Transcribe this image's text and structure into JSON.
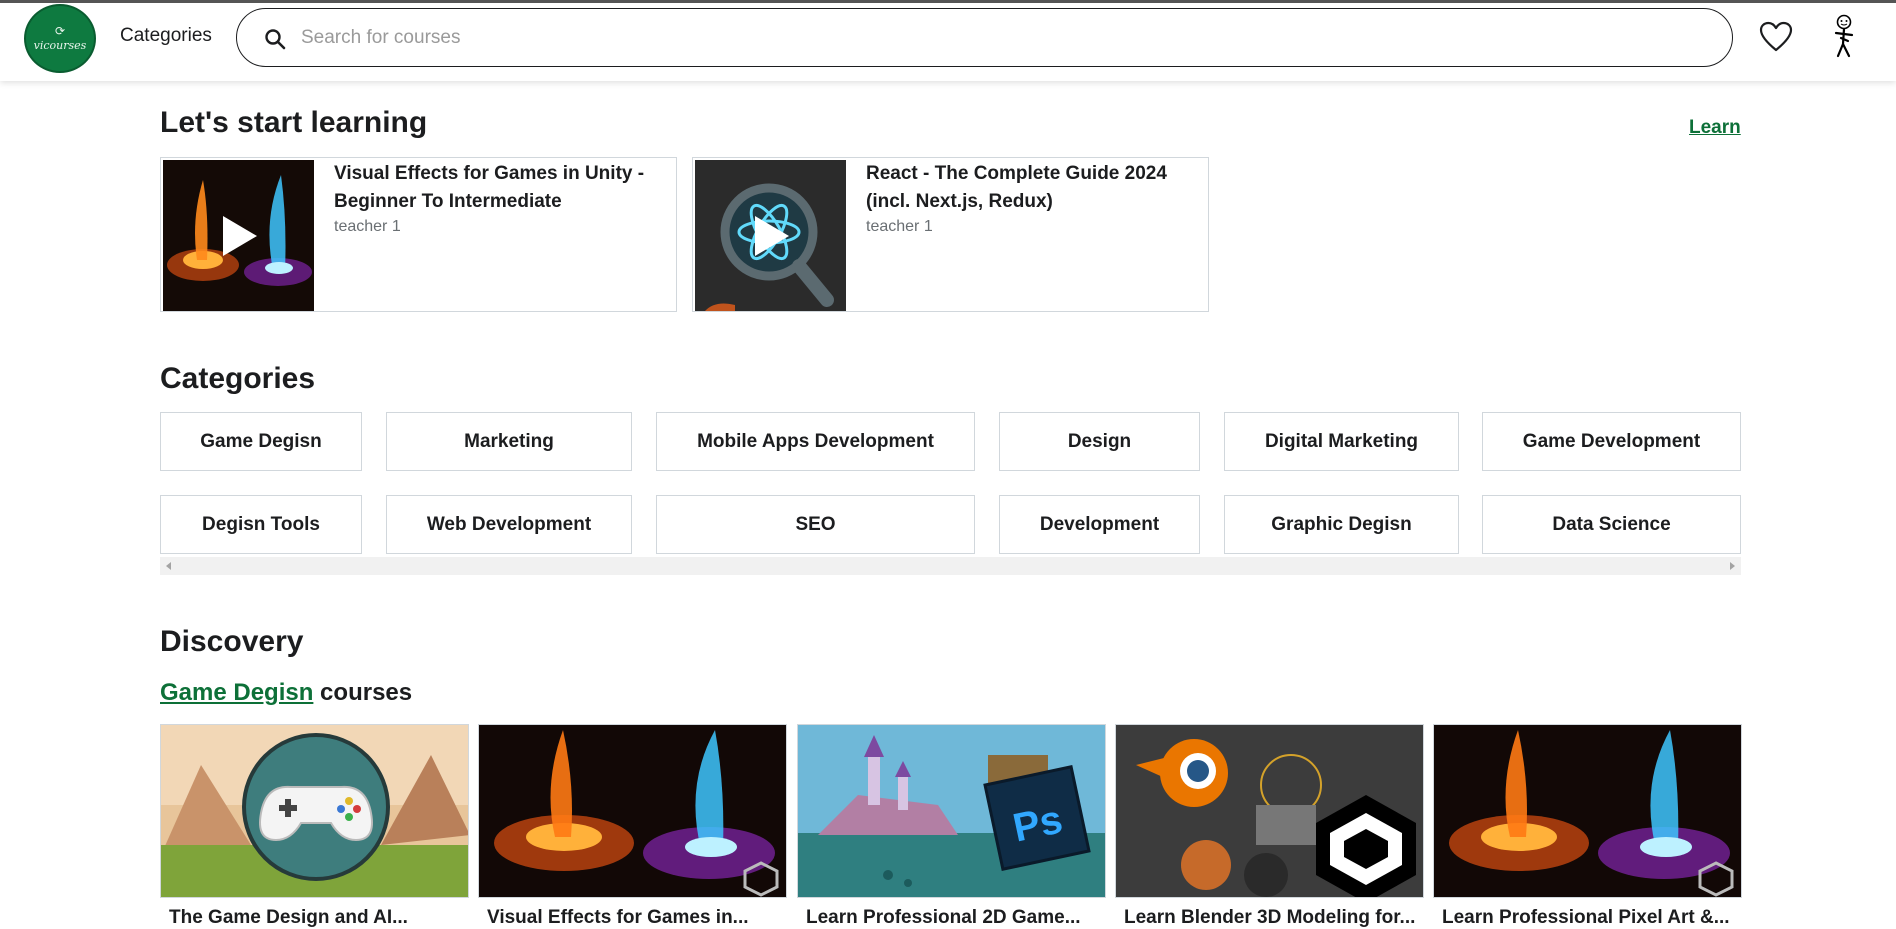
{
  "header": {
    "logo_text": "vicourses",
    "categories_label": "Categories",
    "search_placeholder": "Search for courses",
    "search_value": ""
  },
  "learning": {
    "title": "Let's start learning",
    "learn_link": "Learn",
    "courses": [
      {
        "title": "Visual Effects for Games in Unity - Beginner To Intermediate",
        "teacher": "teacher 1",
        "thumb": "vfx"
      },
      {
        "title": "React - The Complete Guide 2024 (incl. Next.js, Redux)",
        "teacher": "teacher 1",
        "thumb": "react"
      }
    ]
  },
  "categories": {
    "title": "Categories",
    "items": [
      "Game Degisn",
      "Marketing",
      "Mobile Apps Development",
      "Design",
      "Digital Marketing",
      "Game Development",
      "Degisn Tools",
      "Web Development",
      "SEO",
      "Development",
      "Graphic Degisn",
      "Data Science"
    ]
  },
  "discovery": {
    "title": "Discovery",
    "subtitle_link": "Game Degisn",
    "subtitle_suffix": " courses",
    "courses": [
      {
        "title": "The Game Design and AI...",
        "thumb": "controller"
      },
      {
        "title": "Visual Effects for Games in...",
        "thumb": "vfx"
      },
      {
        "title": "Learn Professional 2D Game...",
        "thumb": "castle"
      },
      {
        "title": "Learn Blender 3D Modeling for...",
        "thumb": "blender"
      },
      {
        "title": "Learn Professional Pixel Art &...",
        "thumb": "vfx"
      }
    ]
  },
  "colors": {
    "brand_green": "#0d7038",
    "border": "#d1d7dc",
    "text": "#1c1d1f"
  }
}
